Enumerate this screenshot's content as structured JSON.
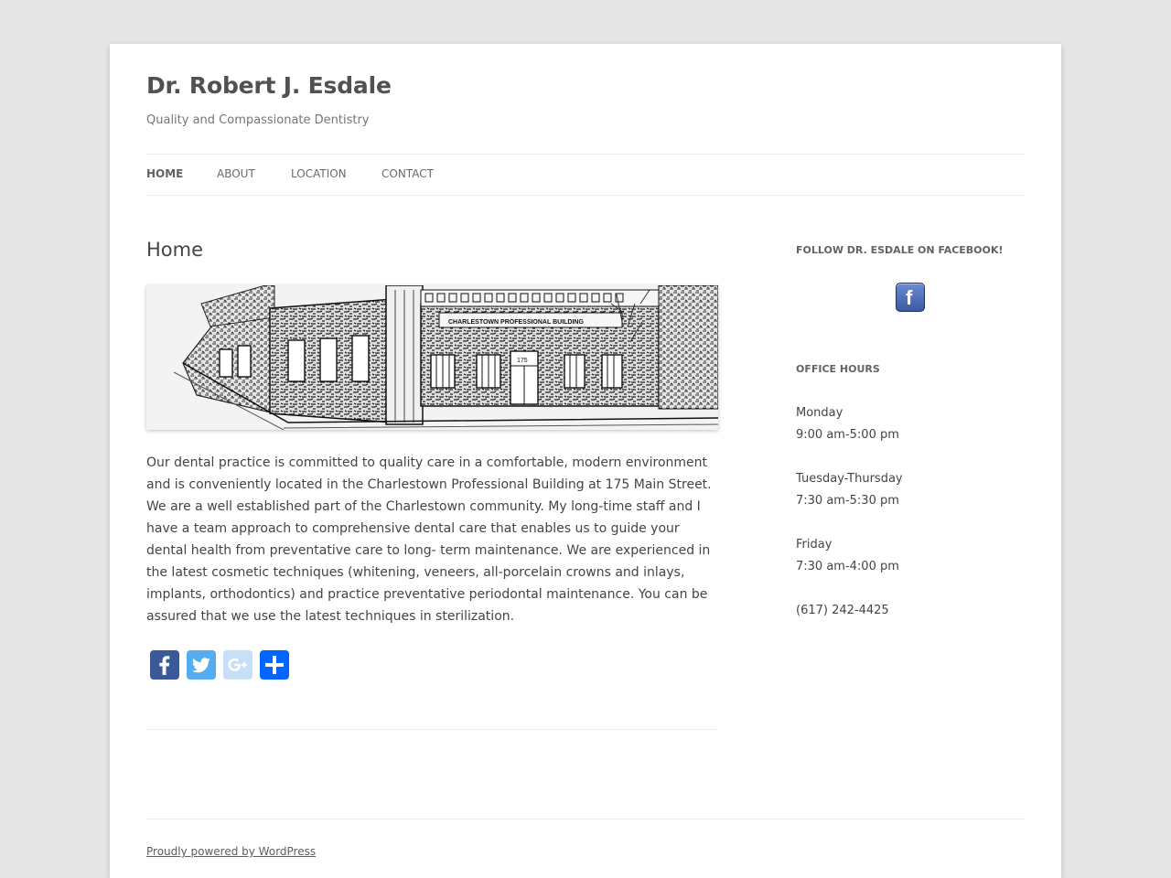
{
  "site": {
    "title": "Dr. Robert J. Esdale",
    "description": "Quality and Compassionate Dentistry"
  },
  "nav": {
    "items": [
      {
        "label": "Home",
        "current": true
      },
      {
        "label": "About",
        "current": false
      },
      {
        "label": "Location",
        "current": false
      },
      {
        "label": "Contact",
        "current": false
      }
    ]
  },
  "main": {
    "title": "Home",
    "hero": {
      "sign_text": "CHARLESTOWN PROFESSIONAL BUILDING",
      "door_number": "175"
    },
    "body": "Our dental practice is committed to quality care in a comfortable, modern environment and is conveniently located in the Charlestown Professional Building at 175 Main Street.  We are a well established part of the Charlestown community.  My long-time staff and I have a team approach to comprehensive dental care that enables us to guide your dental health from preventative care to long- term maintenance.  We are experienced in the latest cosmetic techniques (whitening, veneers, all-porcelain crowns and inlays, implants, orthodontics) and practice preventative periodontal maintenance.  You can be assured that we use the latest techniques in sterilization.",
    "share": [
      {
        "name": "facebook-icon",
        "color": "#3b5998"
      },
      {
        "name": "twitter-icon",
        "color": "#55acee"
      },
      {
        "name": "google-plus-icon",
        "color": "#c7dff7"
      },
      {
        "name": "share-plus-icon",
        "color": "#0166ff"
      }
    ]
  },
  "sidebar": {
    "facebook_title": "Follow Dr. Esdale on Facebook!",
    "facebook_badge_glyph": "f",
    "hours_title": "Office Hours",
    "hours": {
      "monday_day": "Monday",
      "monday_time": "9:00 am-5:00 pm",
      "tue_thu_day": "Tuesday-Thursday",
      "tue_thu_time": "7:30 am-5:30 pm",
      "friday_day": "Friday",
      "friday_time": "7:30 am-4:00 pm",
      "phone": "(617) 242-4425"
    }
  },
  "footer": {
    "powered_by": "Proudly powered by WordPress"
  },
  "colors": {
    "page_bg": "#e6e6e6",
    "content_bg": "#ffffff",
    "text": "#444444"
  }
}
